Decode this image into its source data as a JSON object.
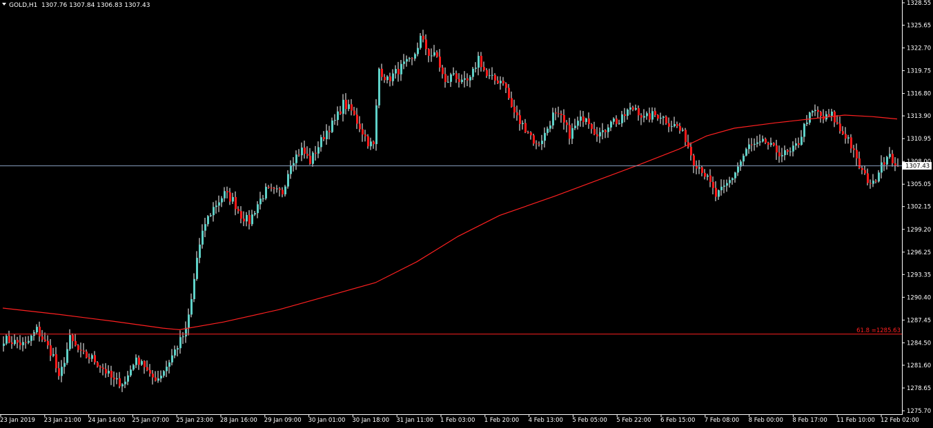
{
  "header": {
    "symbol": "GOLD,H1",
    "ohlc": "1307.76 1307.84 1306.83 1307.43"
  },
  "colors": {
    "background": "#000000",
    "bull": "#5fd1c8",
    "bear": "#ff1a1a",
    "wick": "#ffffff",
    "ma": "#ff2020",
    "fib": "#ff2020",
    "bid_line": "#8aa0c0",
    "axis": "#ffffff"
  },
  "price_label": "1307.43",
  "fib": {
    "label": "61.8 =1285.63",
    "value": 1285.63
  },
  "chart_data": {
    "type": "candlestick",
    "title": "",
    "ylim": [
      1275.7,
      1328.55
    ],
    "y_ticks": [
      "1328.55",
      "1325.65",
      "1322.70",
      "1319.75",
      "1316.80",
      "1313.90",
      "1310.95",
      "1308.00",
      "1305.05",
      "1302.15",
      "1299.20",
      "1296.25",
      "1293.35",
      "1290.40",
      "1287.45",
      "1284.50",
      "1281.60",
      "1278.65",
      "1275.70"
    ],
    "x_ticks": [
      "23 Jan 2019",
      "23 Jan 21:00",
      "24 Jan 14:00",
      "25 Jan 07:00",
      "25 Jan 23:00",
      "28 Jan 16:00",
      "29 Jan 09:00",
      "30 Jan 01:00",
      "30 Jan 18:00",
      "31 Jan 11:00",
      "1 Feb 03:00",
      "1 Feb 20:00",
      "4 Feb 13:00",
      "5 Feb 05:00",
      "5 Feb 22:00",
      "6 Feb 15:00",
      "7 Feb 08:00",
      "8 Feb 00:00",
      "8 Feb 17:00",
      "11 Feb 10:00",
      "12 Feb 02:00"
    ],
    "last_price": 1307.43,
    "anchors": [
      [
        0,
        1285.0
      ],
      [
        8,
        1284.2
      ],
      [
        12,
        1286.2
      ],
      [
        15,
        1284.5
      ],
      [
        18,
        1282.8
      ],
      [
        20,
        1279.7
      ],
      [
        24,
        1285.0
      ],
      [
        28,
        1283.0
      ],
      [
        32,
        1282.5
      ],
      [
        36,
        1281.2
      ],
      [
        40,
        1279.5
      ],
      [
        42,
        1279.4
      ],
      [
        44,
        1279.4
      ],
      [
        47,
        1282.0
      ],
      [
        50,
        1282.3
      ],
      [
        53,
        1280.0
      ],
      [
        56,
        1280.0
      ],
      [
        59,
        1281.5
      ],
      [
        62,
        1283.5
      ],
      [
        66,
        1286.0
      ],
      [
        68,
        1290.0
      ],
      [
        70,
        1295.5
      ],
      [
        73,
        1300.0
      ],
      [
        76,
        1302.0
      ],
      [
        80,
        1303.8
      ],
      [
        83,
        1303.0
      ],
      [
        86,
        1301.0
      ],
      [
        89,
        1300.2
      ],
      [
        92,
        1302.5
      ],
      [
        95,
        1304.2
      ],
      [
        98,
        1304.0
      ],
      [
        101,
        1304.0
      ],
      [
        104,
        1308.0
      ],
      [
        108,
        1309.5
      ],
      [
        111,
        1308.0
      ],
      [
        114,
        1310.0
      ],
      [
        117,
        1312.0
      ],
      [
        120,
        1313.2
      ],
      [
        123,
        1315.5
      ],
      [
        126,
        1314.5
      ],
      [
        129,
        1312.5
      ],
      [
        132,
        1310.5
      ],
      [
        134,
        1310.0
      ],
      [
        136,
        1320.0
      ],
      [
        139,
        1318.5
      ],
      [
        142,
        1319.5
      ],
      [
        145,
        1320.5
      ],
      [
        148,
        1321.0
      ],
      [
        151,
        1324.0
      ],
      [
        154,
        1322.0
      ],
      [
        157,
        1321.5
      ],
      [
        160,
        1318.0
      ],
      [
        163,
        1319.5
      ],
      [
        166,
        1318.0
      ],
      [
        169,
        1318.5
      ],
      [
        172,
        1321.5
      ],
      [
        175,
        1319.0
      ],
      [
        178,
        1318.5
      ],
      [
        181,
        1318.5
      ],
      [
        184,
        1315.0
      ],
      [
        187,
        1313.0
      ],
      [
        190,
        1312.0
      ],
      [
        193,
        1310.0
      ],
      [
        196,
        1311.5
      ],
      [
        199,
        1314.0
      ],
      [
        202,
        1313.5
      ],
      [
        205,
        1311.5
      ],
      [
        208,
        1313.0
      ],
      [
        211,
        1314.0
      ],
      [
        214,
        1312.0
      ],
      [
        217,
        1311.5
      ],
      [
        220,
        1313.5
      ],
      [
        223,
        1313.0
      ],
      [
        226,
        1314.5
      ],
      [
        229,
        1315.0
      ],
      [
        232,
        1313.5
      ],
      [
        235,
        1314.0
      ],
      [
        238,
        1314.0
      ],
      [
        241,
        1313.0
      ],
      [
        244,
        1312.5
      ],
      [
        247,
        1311.0
      ],
      [
        250,
        1308.0
      ],
      [
        253,
        1307.0
      ],
      [
        256,
        1305.0
      ],
      [
        258,
        1303.5
      ],
      [
        261,
        1304.5
      ],
      [
        264,
        1306.0
      ],
      [
        267,
        1308.0
      ],
      [
        270,
        1310.0
      ],
      [
        273,
        1310.0
      ],
      [
        276,
        1310.5
      ],
      [
        279,
        1309.5
      ],
      [
        282,
        1309.0
      ],
      [
        285,
        1309.0
      ],
      [
        288,
        1310.5
      ],
      [
        291,
        1313.5
      ],
      [
        294,
        1314.5
      ],
      [
        297,
        1313.5
      ],
      [
        300,
        1314.0
      ],
      [
        303,
        1312.0
      ],
      [
        306,
        1311.0
      ],
      [
        309,
        1308.0
      ],
      [
        312,
        1306.0
      ],
      [
        315,
        1305.0
      ],
      [
        318,
        1308.0
      ],
      [
        321,
        1308.5
      ],
      [
        324,
        1307.43
      ]
    ],
    "ma": [
      [
        0,
        1289.0
      ],
      [
        20,
        1288.2
      ],
      [
        40,
        1287.3
      ],
      [
        58,
        1286.4
      ],
      [
        64,
        1286.2
      ],
      [
        80,
        1287.2
      ],
      [
        100,
        1288.8
      ],
      [
        120,
        1290.8
      ],
      [
        135,
        1292.3
      ],
      [
        150,
        1295.0
      ],
      [
        165,
        1298.3
      ],
      [
        180,
        1301.0
      ],
      [
        200,
        1303.5
      ],
      [
        215,
        1305.5
      ],
      [
        230,
        1307.5
      ],
      [
        245,
        1309.6
      ],
      [
        255,
        1311.3
      ],
      [
        265,
        1312.3
      ],
      [
        280,
        1313.0
      ],
      [
        295,
        1313.6
      ],
      [
        305,
        1314.0
      ],
      [
        315,
        1313.8
      ],
      [
        324,
        1313.5
      ]
    ]
  }
}
